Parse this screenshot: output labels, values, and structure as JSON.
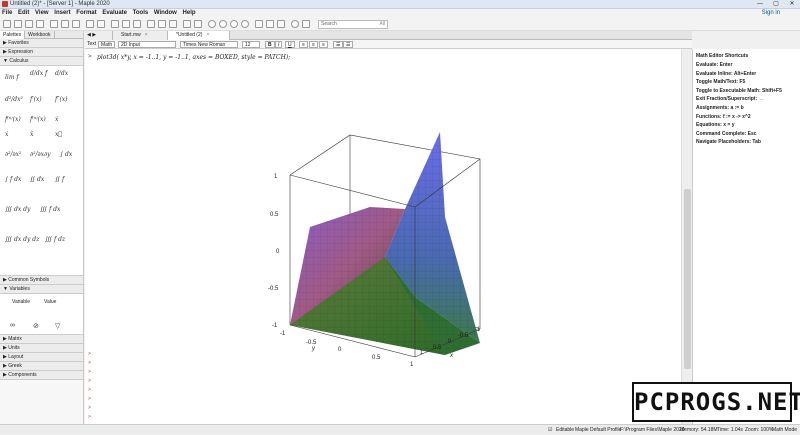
{
  "window": {
    "title": "Untitled (2)* - [Server 1] - Maple 2020",
    "minimize": "—",
    "maximize": "▢",
    "close": "✕"
  },
  "menu": {
    "items": [
      "File",
      "Edit",
      "View",
      "Insert",
      "Format",
      "Evaluate",
      "Tools",
      "Window",
      "Help"
    ],
    "signin": "Sign in"
  },
  "toolbar": {
    "search_placeholder": "Search",
    "search_scope": "All"
  },
  "sidebar": {
    "tabs": [
      "Palettes",
      "Workbook"
    ],
    "sections_top": [
      "Favorites",
      "Expression",
      "Calculus"
    ],
    "sections_mid": [
      "Common Symbols",
      "Variables"
    ],
    "variables_headers": [
      "Variable",
      "Value"
    ],
    "sections_bottom": [
      "Matrix",
      "Units",
      "Layout",
      "Greek",
      "Components"
    ]
  },
  "document_tabs": [
    {
      "label": "Start.mw"
    },
    {
      "label": "*Untitled (2)"
    }
  ],
  "format_bar": {
    "mode_text": "Text",
    "mode_math": "Math",
    "input_style": "2D Input",
    "font": "Times New Roman",
    "size": "12"
  },
  "document": {
    "prompt": ">",
    "command": "plot3d( x*y, x = -1..1, y = -1..1, axes = BOXED, style = PATCH);"
  },
  "plot": {
    "z_ticks": [
      "1",
      "0.5",
      "0",
      "-0.5",
      "-1"
    ],
    "y_ticks": [
      "-1",
      "-0.5",
      "0",
      "0.5",
      "1"
    ],
    "x_ticks": [
      "1",
      "0.5",
      "0",
      "-0.5",
      "-1"
    ],
    "y_label": "y",
    "x_label": "x"
  },
  "right_panel": {
    "title": "Math Editor Shortcuts",
    "lines": [
      "Evaluate: Enter",
      "Evaluate Inline: Alt+Enter",
      "Toggle Math/Text: F5",
      "Toggle to Executable Math: Shift+F5",
      "Exit Fraction/Superscript: →",
      "Assignments: a := b",
      "Functions: f := x -> x^2",
      "Equations: x = y",
      "Command Complete: Esc",
      "Navigate Placeholders: Tab"
    ]
  },
  "status_bar": {
    "editable": "Editable",
    "profile": "Maple Default Profile",
    "path": "F:\\Program Files\\Maple 2020",
    "memory": "Memory: 54.18M",
    "time": "Time: 1.04s",
    "zoom": "Zoom: 100%",
    "mode": "Math Mode"
  },
  "watermark": "PCPROGS.NET"
}
